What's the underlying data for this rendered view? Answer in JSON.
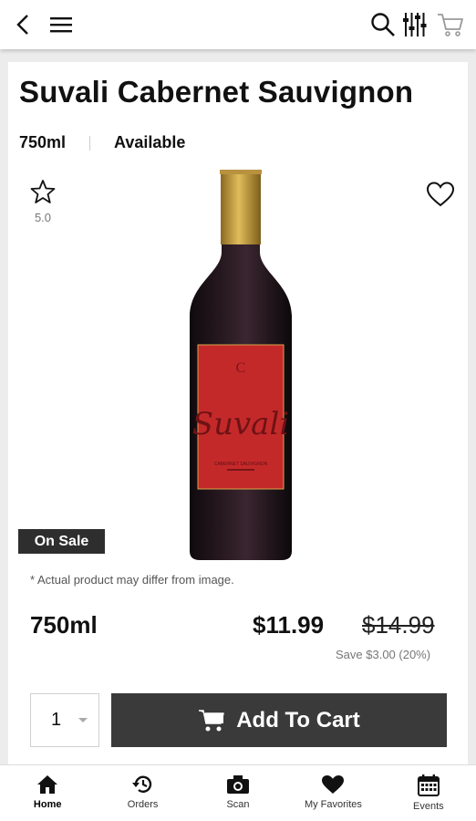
{
  "header": {
    "back_icon": "chevron-left-icon",
    "menu_icon": "hamburger-icon",
    "search_icon": "search-icon",
    "filter_icon": "filter-sliders-icon",
    "cart_icon": "cart-icon"
  },
  "product": {
    "name": "Suvali Cabernet Sauvignon",
    "size": "750ml",
    "availability": "Available",
    "rating": "5.0",
    "badge": "On Sale",
    "disclaimer": "* Actual product may differ from image.",
    "price_size": "750ml",
    "price": "$11.99",
    "original_price": "$14.99",
    "savings": "Save $3.00 (20%)",
    "label_brand": "Suvali",
    "label_subtitle": "CABERNET SAUVIGNON"
  },
  "cart": {
    "quantity": "1",
    "add_label": "Add To Cart"
  },
  "nav": {
    "items": [
      {
        "label": "Home",
        "icon": "home-icon",
        "active": true
      },
      {
        "label": "Orders",
        "icon": "history-icon",
        "active": false
      },
      {
        "label": "Scan",
        "icon": "camera-icon",
        "active": false
      },
      {
        "label": "My Favorites",
        "icon": "heart-icon",
        "active": false
      },
      {
        "label": "Events",
        "icon": "calendar-icon",
        "active": false
      }
    ]
  },
  "colors": {
    "label_red": "#c4292a",
    "bottle_dark": "#1a1216",
    "capsule_gold": "#c9a13b",
    "button_dark": "#3a3a3a"
  }
}
